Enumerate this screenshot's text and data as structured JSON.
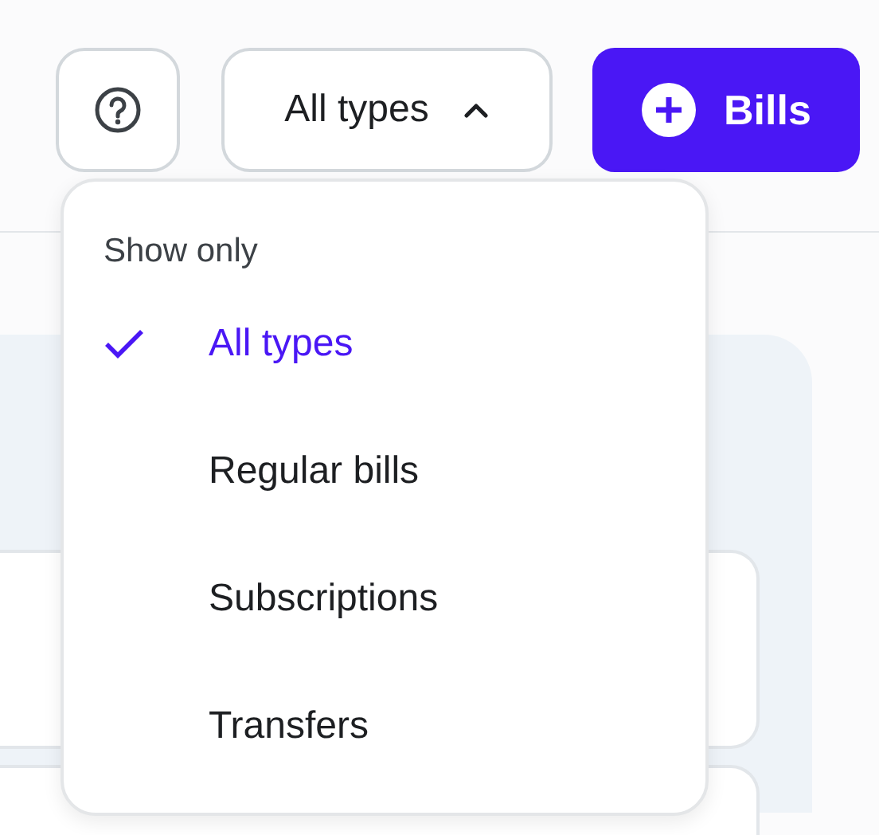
{
  "toolbar": {
    "filter": {
      "label": "All types",
      "expanded": true
    },
    "add_button": {
      "label": "Bills"
    }
  },
  "filter_menu": {
    "heading": "Show only",
    "items": [
      {
        "label": "All types",
        "selected": true
      },
      {
        "label": "Regular bills",
        "selected": false
      },
      {
        "label": "Subscriptions",
        "selected": false
      },
      {
        "label": "Transfers",
        "selected": false
      }
    ]
  }
}
